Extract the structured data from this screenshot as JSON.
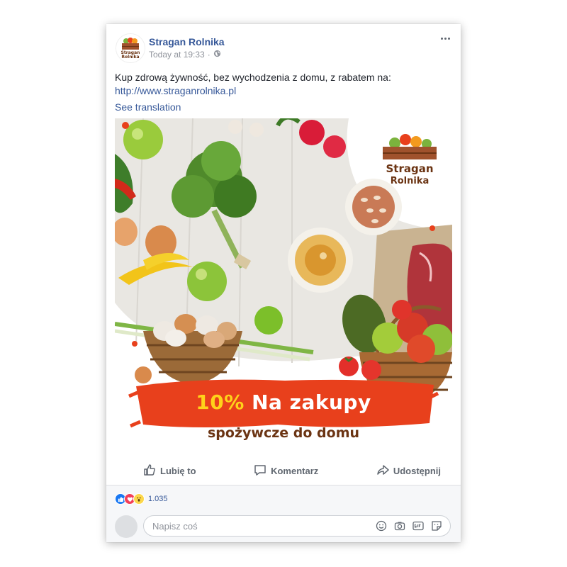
{
  "post": {
    "page_name": "Stragan Rolnika",
    "timestamp": "Today at 19:33",
    "separator": "·",
    "audience_icon": "globe-icon",
    "text": "Kup zdrową żywność, bez wychodzenia z domu, z rabatem na:",
    "link": "http://www.straganrolnika.pl",
    "see_translation": "See translation"
  },
  "ad": {
    "logo_line1": "Stragan",
    "logo_line2": "Rolnika",
    "promo_percent": "10%",
    "promo_rest": "Na zakupy",
    "promo_sub": "spożywcze do domu",
    "colors": {
      "banner": "#e8401c",
      "percent": "#ffd21a",
      "subtitle": "#6b3413"
    }
  },
  "actions": {
    "like": "Lubię to",
    "comment": "Komentarz",
    "share": "Udostępnij"
  },
  "reactions": {
    "icons": [
      "like-reaction-icon",
      "love-reaction-icon",
      "wow-reaction-icon"
    ],
    "count": "1.035"
  },
  "comment": {
    "placeholder": "Napisz coś",
    "icons": [
      "emoji-icon",
      "camera-icon",
      "gif-icon",
      "sticker-icon"
    ]
  }
}
